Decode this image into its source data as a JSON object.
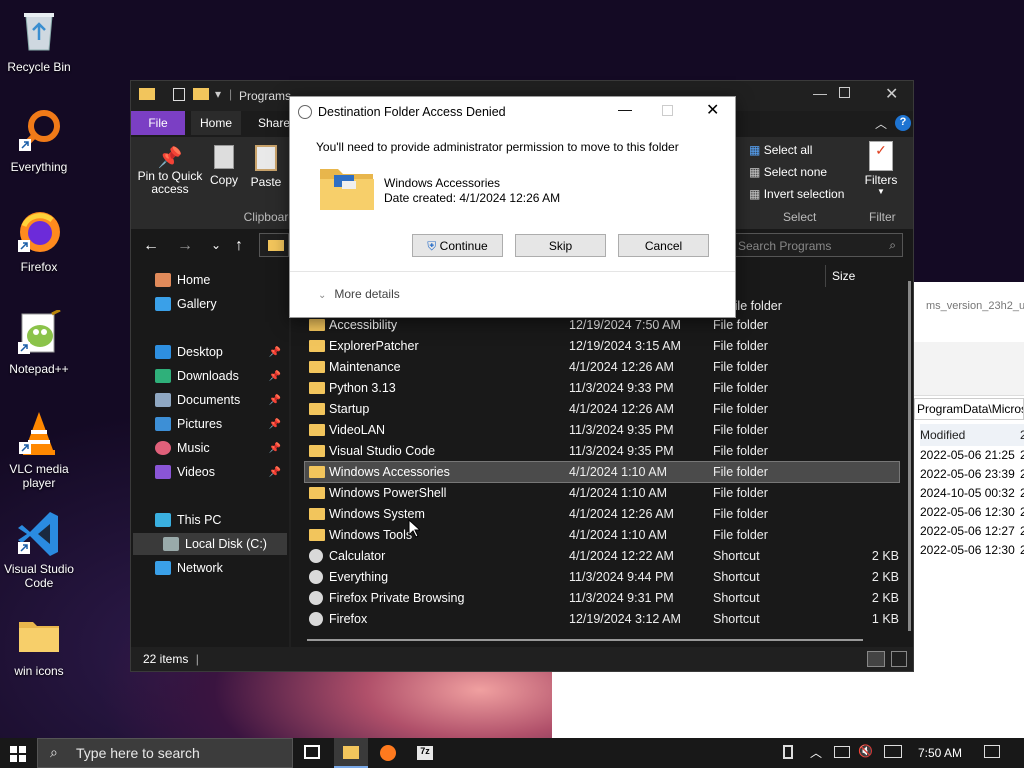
{
  "desktop": {
    "icons": [
      {
        "label": "Recycle Bin",
        "icon": "recycle-bin-icon"
      },
      {
        "label": "Everything",
        "icon": "everything-icon"
      },
      {
        "label": "Firefox",
        "icon": "firefox-icon"
      },
      {
        "label": "Notepad++",
        "icon": "notepad-plus-plus-icon"
      },
      {
        "label": "VLC media player",
        "icon": "vlc-icon"
      },
      {
        "label": "Visual Studio Code",
        "icon": "vscode-icon"
      },
      {
        "label": "win icons",
        "icon": "folder-icon"
      }
    ]
  },
  "bg_window": {
    "title_fragment": "ms_version_23h2_upd",
    "path": "ProgramData\\Micros",
    "col_modified": "Modified",
    "rows": [
      "2022-05-06 21:25",
      "2022-05-06 23:39",
      "2024-10-05 00:32",
      "2022-05-06 12:30",
      "2022-05-06 12:27",
      "2022-05-06 12:30"
    ],
    "row_suffix": "2"
  },
  "explorer": {
    "title": "Programs",
    "tabs": {
      "file": "File",
      "home": "Home",
      "share": "Share"
    },
    "ribbon": {
      "pin": "Pin to Quick access",
      "copy": "Copy",
      "paste": "Paste",
      "clipboard": "Clipboard",
      "select_all": "Select all",
      "select_none": "Select none",
      "invert": "Invert selection",
      "select_group": "Select",
      "filters": "Filters",
      "filter_group": "Filter"
    },
    "search_placeholder": "Search Programs",
    "col_size": "Size",
    "sidebar": {
      "home": "Home",
      "gallery": "Gallery",
      "desktop": "Desktop",
      "downloads": "Downloads",
      "documents": "Documents",
      "pictures": "Pictures",
      "music": "Music",
      "videos": "Videos",
      "thispc": "This PC",
      "localdisk": "Local Disk (C:)",
      "network": "Network"
    },
    "partial_row_type": "File folder",
    "rows": [
      {
        "name": "Accessibility",
        "date": "12/19/2024 7:50 AM",
        "type": "File folder",
        "size": "",
        "kind": "folder"
      },
      {
        "name": "ExplorerPatcher",
        "date": "12/19/2024 3:15 AM",
        "type": "File folder",
        "size": "",
        "kind": "folder"
      },
      {
        "name": "Maintenance",
        "date": "4/1/2024 12:26 AM",
        "type": "File folder",
        "size": "",
        "kind": "folder"
      },
      {
        "name": "Python 3.13",
        "date": "11/3/2024 9:33 PM",
        "type": "File folder",
        "size": "",
        "kind": "folder"
      },
      {
        "name": "Startup",
        "date": "4/1/2024 12:26 AM",
        "type": "File folder",
        "size": "",
        "kind": "folder"
      },
      {
        "name": "VideoLAN",
        "date": "11/3/2024 9:35 PM",
        "type": "File folder",
        "size": "",
        "kind": "folder"
      },
      {
        "name": "Visual Studio Code",
        "date": "11/3/2024 9:35 PM",
        "type": "File folder",
        "size": "",
        "kind": "folder"
      },
      {
        "name": "Windows Accessories",
        "date": "4/1/2024 1:10 AM",
        "type": "File folder",
        "size": "",
        "kind": "folder",
        "selected": true
      },
      {
        "name": "Windows PowerShell",
        "date": "4/1/2024 1:10 AM",
        "type": "File folder",
        "size": "",
        "kind": "folder"
      },
      {
        "name": "Windows System",
        "date": "4/1/2024 12:26 AM",
        "type": "File folder",
        "size": "",
        "kind": "folder"
      },
      {
        "name": "Windows Tools",
        "date": "4/1/2024 1:10 AM",
        "type": "File folder",
        "size": "",
        "kind": "folder"
      },
      {
        "name": "Calculator",
        "date": "4/1/2024 12:22 AM",
        "type": "Shortcut",
        "size": "2 KB",
        "kind": "shortcut"
      },
      {
        "name": "Everything",
        "date": "11/3/2024 9:44 PM",
        "type": "Shortcut",
        "size": "2 KB",
        "kind": "shortcut"
      },
      {
        "name": "Firefox Private Browsing",
        "date": "11/3/2024 9:31 PM",
        "type": "Shortcut",
        "size": "2 KB",
        "kind": "shortcut"
      },
      {
        "name": "Firefox",
        "date": "12/19/2024 3:12 AM",
        "type": "Shortcut",
        "size": "1 KB",
        "kind": "shortcut"
      }
    ],
    "status": "22 items"
  },
  "dialog": {
    "title": "Destination Folder Access Denied",
    "message": "You'll need to provide administrator permission to move to this folder",
    "folder_name": "Windows Accessories",
    "date_created": "Date created: 4/1/2024 12:26 AM",
    "continue": "Continue",
    "skip": "Skip",
    "cancel": "Cancel",
    "more_details": "More details"
  },
  "taskbar": {
    "search_placeholder": "Type here to search",
    "time": "7:50 AM"
  }
}
